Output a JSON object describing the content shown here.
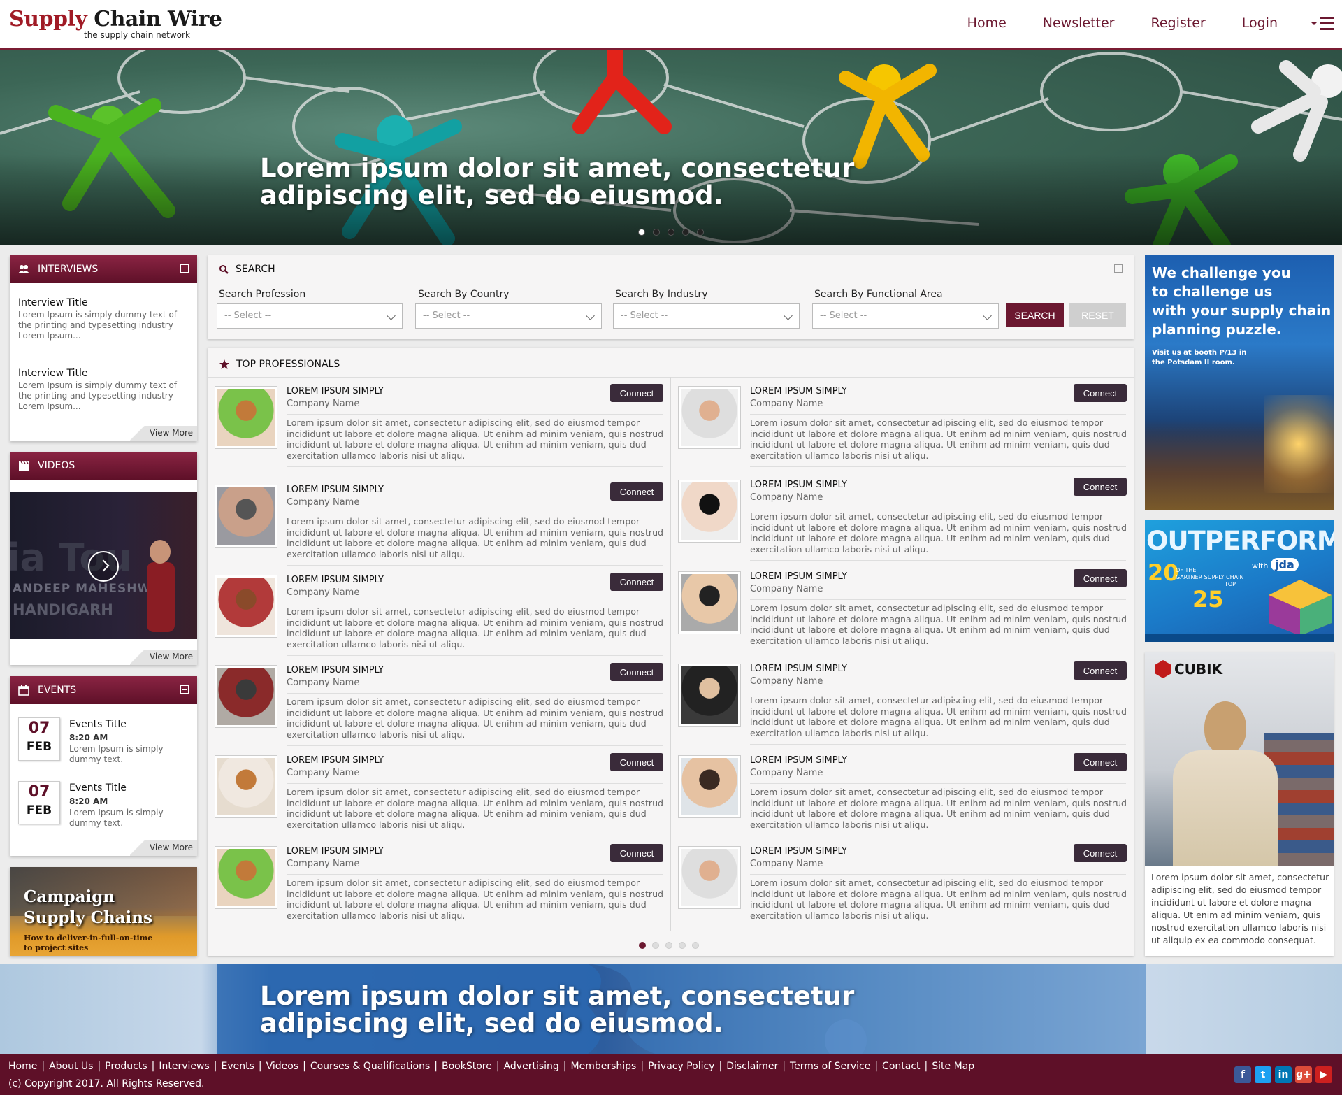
{
  "header": {
    "logo_main_1": "Supply",
    "logo_main_2": "Chain Wire",
    "logo_tagline": "the supply chain network",
    "nav": [
      "Home",
      "Newsletter",
      "Register",
      "Login"
    ]
  },
  "hero": {
    "title_line1": "Lorem ipsum dolor sit amet, consectetur",
    "title_line2": "adipiscing elit, sed do eiusmod.",
    "active_slide": 1,
    "slide_count": 5
  },
  "interviews": {
    "title": "INTERVIEWS",
    "items": [
      {
        "title": "Interview Title",
        "text": "Lorem Ipsum is simply dummy text of the printing and typesetting industry Lorem Ipsum..."
      },
      {
        "title": "Interview Title",
        "text": "Lorem Ipsum is simply dummy text of the printing and typesetting industry Lorem Ipsum..."
      }
    ],
    "view_more": "View More"
  },
  "videos": {
    "title": "VIDEOS",
    "video_text_1": "ia Tou",
    "video_text_2": "ANDEEP MAHESHWAR",
    "video_text_3": "HANDIGARH",
    "view_more": "View More"
  },
  "events": {
    "title": "EVENTS",
    "items": [
      {
        "day": "07",
        "month": "FEB",
        "title": "Events Title",
        "time": "8:20 AM",
        "text": "Lorem Ipsum is simply dummy text."
      },
      {
        "day": "07",
        "month": "FEB",
        "title": "Events Title",
        "time": "8:20 AM",
        "text": "Lorem Ipsum is simply dummy text."
      }
    ],
    "view_more": "View More"
  },
  "campaign": {
    "line1": "Campaign",
    "line2": "Supply Chains",
    "line3": "How to deliver-in-full-on-time",
    "line4": "to project sites"
  },
  "search": {
    "title": "SEARCH",
    "fields": [
      {
        "label": "Search Profession",
        "value": "-- Select --"
      },
      {
        "label": "Search By Country",
        "value": "-- Select --"
      },
      {
        "label": "Search By Industry",
        "value": "-- Select --"
      },
      {
        "label": "Search By Functional Area",
        "value": "-- Select --"
      }
    ],
    "search_button": "SEARCH",
    "reset_button": "RESET"
  },
  "professionals": {
    "title": "TOP PROFESSIONALS",
    "connect_label": "Connect",
    "name": "LOREM IPSUM SIMPLY",
    "company": "Company Name",
    "desc": "Lorem ipsum dolor sit amet, consectetur adipiscing elit, sed do eiusmod tempor incididunt ut labore et dolore magna aliqua. Ut enihm ad minim veniam, quis nostrud incididunt ut labore et dolore magna aliqua. Ut enihm ad minim veniam, quis dud exercitation ullamco laboris nisi ut aliqu.",
    "active_page": 1,
    "page_count": 5
  },
  "ads": {
    "ad1_line1": "We challenge you",
    "ad1_line2": "to challenge us",
    "ad1_line3": "with your supply chain",
    "ad1_line4": "planning puzzle.",
    "ad1_small1": "Visit us at booth P/13 in",
    "ad1_small2": "the Potsdam II room.",
    "ad2_title": "OUTPERFORM",
    "ad2_with": "with",
    "ad2_brand": "jda",
    "ad2_num1": "20",
    "ad2_of": "OF THE",
    "ad2_gartner": "GARTNER SUPPLY CHAIN",
    "ad2_top": "TOP",
    "ad2_num2": "25",
    "ad3_brand": "CUBIK",
    "ad3_text": "Lorem ipsum dolor sit amet, consectetur adipiscing elit, sed do eiusmod tempor incididunt ut labore et dolore magna aliqua. Ut enim ad minim veniam, quis nostrud exercitation ullamco laboris nisi ut aliquip ex ea commodo consequat."
  },
  "banner2": {
    "title_line1": "Lorem ipsum dolor sit amet, consectetur",
    "title_line2": "adipiscing elit, sed do eiusmod."
  },
  "footer": {
    "links": [
      "Home",
      "About Us",
      "Products",
      "Interviews",
      "Events",
      "Videos",
      "Courses & Qualifications",
      "BookStore",
      "Advertising",
      "Memberships",
      "Privacy Policy",
      "Disclaimer",
      "Terms of Service",
      "Contact",
      "Site Map"
    ],
    "copyright": "(c) Copyright 2017. All Rights Reserved.",
    "social": [
      {
        "name": "facebook-icon",
        "glyph": "f",
        "color": "#3b5998"
      },
      {
        "name": "twitter-icon",
        "glyph": "t",
        "color": "#1da1f2"
      },
      {
        "name": "linkedin-icon",
        "glyph": "in",
        "color": "#0077b5"
      },
      {
        "name": "google-plus-icon",
        "glyph": "g+",
        "color": "#dd4b39"
      },
      {
        "name": "youtube-icon",
        "glyph": "▶",
        "color": "#cd201f"
      }
    ]
  },
  "colors": {
    "brand": "#6b1830",
    "brand_dark": "#5e1028",
    "connect": "#3a2b3a"
  }
}
